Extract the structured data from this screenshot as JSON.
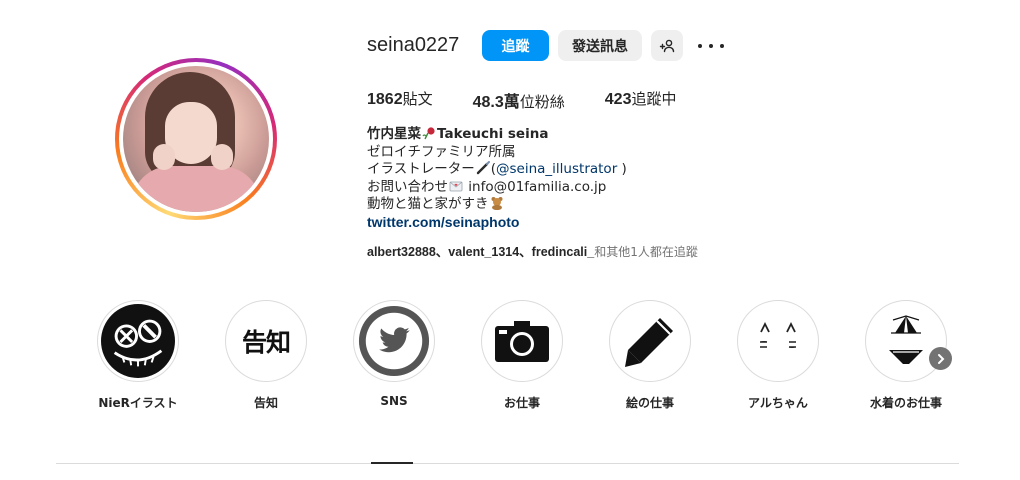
{
  "profile": {
    "username": "seina0227",
    "follow_label": "追蹤",
    "message_label": "發送訊息"
  },
  "stats": {
    "posts_count": "1862",
    "posts_label": "貼文",
    "followers_count": "48.3萬",
    "followers_label": "位粉絲",
    "following_count": "423",
    "following_label": "追蹤中"
  },
  "bio": {
    "name": "竹内星菜",
    "name_suffix": "Takeuchi seina",
    "line1": "ゼロイチファミリア所属",
    "line2_prefix": "イラストレーター",
    "line2_open": "(",
    "line2_mention": "@seina_illustrator",
    "line2_close": " )",
    "line3_prefix": "お問い合わせ",
    "line3_email": " info@01familia.co.jp",
    "line4": "動物と猫と家がすき",
    "website": "twitter.com/seinaphoto"
  },
  "followed_by": {
    "users": "albert32888、valent_1314、fredincali_",
    "suffix": "和其他1人都在追蹤"
  },
  "highlights": [
    {
      "label": "NieRイラスト",
      "icon": "nier-icon"
    },
    {
      "label": "告知",
      "icon": "announcement-text",
      "text": "告知"
    },
    {
      "label": "SNS",
      "icon": "twitter-bird-icon"
    },
    {
      "label": "お仕事",
      "icon": "camera-icon"
    },
    {
      "label": "絵の仕事",
      "icon": "pencil-icon"
    },
    {
      "label": "アルちゃん",
      "icon": "cat-face-icon"
    },
    {
      "label": "水着のお仕事",
      "icon": "bikini-icon"
    }
  ],
  "colors": {
    "follow_button": "#0095f6",
    "secondary_button": "#efefef",
    "link": "#00376b"
  }
}
